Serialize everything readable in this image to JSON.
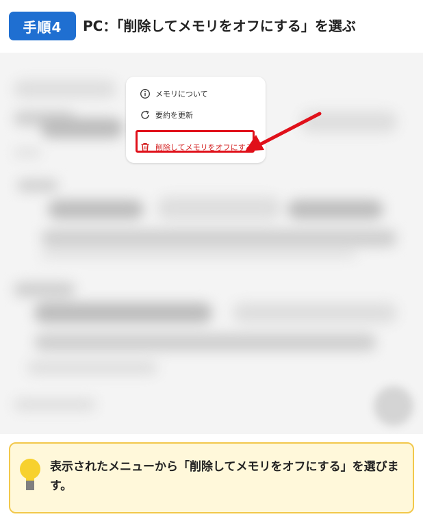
{
  "header": {
    "step_label": "手順4",
    "title": "PC：「削除してメモリをオフにする」を選ぶ"
  },
  "menu": {
    "items": [
      {
        "label": "メモリについて",
        "icon": "info-icon"
      },
      {
        "label": "要約を更新",
        "icon": "refresh-icon"
      },
      {
        "label": "削除してメモリをオフにする",
        "icon": "trash-icon",
        "color": "#d31f1f"
      }
    ]
  },
  "note": {
    "text": "表示されたメニューから「削除してメモリをオフにする」を選びます。",
    "icon": "lightbulb-icon"
  },
  "colors": {
    "badge": "#1f6fd1",
    "highlight": "#e0101a",
    "note_bg": "#fff8da",
    "note_border": "#f2c84b"
  }
}
